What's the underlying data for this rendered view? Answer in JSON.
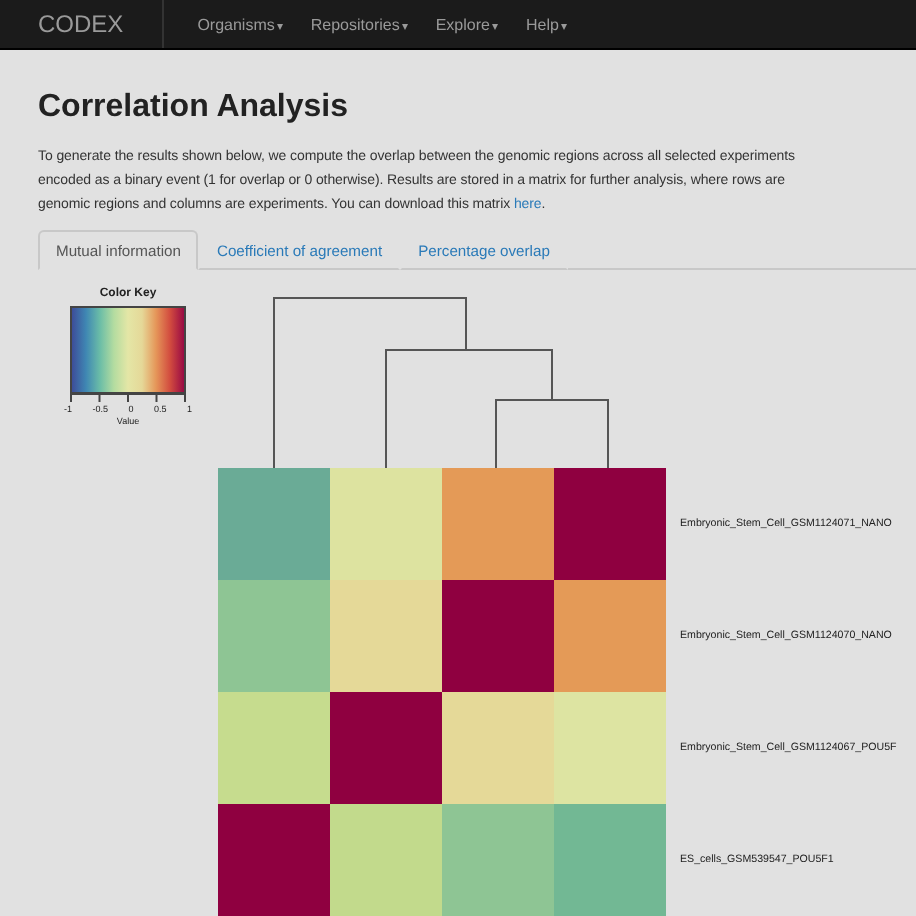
{
  "navbar": {
    "brand": "CODEX",
    "menus": [
      {
        "label": "Organisms",
        "caret": "▾"
      },
      {
        "label": "Repositories",
        "caret": "▾"
      },
      {
        "label": "Explore",
        "caret": "▾"
      },
      {
        "label": "Help",
        "caret": "▾"
      }
    ]
  },
  "title": "Correlation Analysis",
  "intro": {
    "lines": [
      "To generate the results shown below, we compute the overlap between the genomic regions across all selected experiments",
      "encoded as a binary event (1 for overlap or 0 otherwise). Results are stored in a matrix for further analysis, where rows are",
      "genomic regions and columns are experiments. You can download this matrix"
    ],
    "link": "here",
    "end": "."
  },
  "tabs": [
    {
      "label": "Mutual information",
      "selected": true
    },
    {
      "label": "Coefficient of agreement",
      "selected": false
    },
    {
      "label": "Percentage overlap",
      "selected": false
    }
  ],
  "color_key": {
    "title": "Color Key",
    "ticks": [
      "-1",
      "-0.5",
      "0",
      "0.5",
      "1"
    ],
    "xlabel": "Value"
  },
  "heatmap": {
    "rows": [
      {
        "label": "Embryonic_Stem_Cell_GSM1124071_NANO",
        "cells": [
          {
            "color": "#6aab96"
          },
          {
            "color": "#dde3a0"
          },
          {
            "color": "#e49a57"
          },
          {
            "color": "#8f0040"
          }
        ]
      },
      {
        "label": "Embryonic_Stem_Cell_GSM1124070_NANO",
        "cells": [
          {
            "color": "#8ec594"
          },
          {
            "color": "#e5d998"
          },
          {
            "color": "#8f0040"
          },
          {
            "color": "#e49a57"
          }
        ]
      },
      {
        "label": "Embryonic_Stem_Cell_GSM1124067_POU5F",
        "cells": [
          {
            "color": "#c6dc8e"
          },
          {
            "color": "#8f0040"
          },
          {
            "color": "#e5d998"
          },
          {
            "color": "#dde4a2"
          }
        ]
      },
      {
        "label": "ES_cells_GSM539547_POU5F1",
        "cells": [
          {
            "color": "#8f0040"
          },
          {
            "color": "#c2da8c"
          },
          {
            "color": "#8ec594"
          },
          {
            "color": "#72b894"
          }
        ]
      }
    ]
  }
}
